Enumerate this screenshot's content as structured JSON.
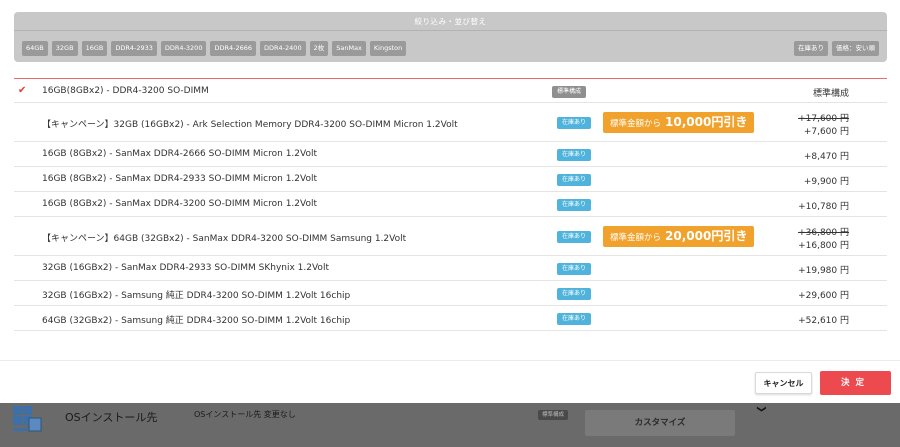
{
  "filter": {
    "title": "絞り込み・並び替え",
    "chips": [
      "64GB",
      "32GB",
      "16GB",
      "DDR4-2933",
      "DDR4-3200",
      "DDR4-2666",
      "DDR4-2400",
      "2枚",
      "SanMax",
      "Kingston"
    ],
    "sort_chips": [
      "在庫あり",
      "価格：安い順"
    ]
  },
  "options": [
    {
      "name": "16GB(8GBx2) - DDR4-3200 SO-DIMM",
      "selected": true,
      "badge": "標準構成",
      "price": "標準構成"
    },
    {
      "name": "【キャンペーン】32GB (16GBx2) - Ark Selection Memory DDR4-3200 SO-DIMM Micron 1.2Volt",
      "badge": "在庫あり",
      "promo_label": "標準金額から",
      "promo_amount": "10,000円引き",
      "old_price": "+17,600 円",
      "price": "+7,600 円"
    },
    {
      "name": "16GB (8GBx2) - SanMax DDR4-2666 SO-DIMM Micron 1.2Volt",
      "badge": "在庫あり",
      "price": "+8,470 円"
    },
    {
      "name": "16GB (8GBx2) - SanMax DDR4-2933 SO-DIMM Micron 1.2Volt",
      "badge": "在庫あり",
      "price": "+9,900 円"
    },
    {
      "name": "16GB (8GBx2) - SanMax DDR4-3200 SO-DIMM Micron 1.2Volt",
      "badge": "在庫あり",
      "price": "+10,780 円"
    },
    {
      "name": "【キャンペーン】64GB (32GBx2) - SanMax DDR4-3200 SO-DIMM Samsung 1.2Volt",
      "badge": "在庫あり",
      "promo_label": "標準金額から",
      "promo_amount": "20,000円引き",
      "old_price": "+36,800 円",
      "price": "+16,800 円"
    },
    {
      "name": "32GB (16GBx2) - SanMax DDR4-2933 SO-DIMM SKhynix 1.2Volt",
      "badge": "在庫あり",
      "price": "+19,980 円"
    },
    {
      "name": "32GB (16GBx2) - Samsung 純正 DDR4-3200 SO-DIMM 1.2Volt 16chip",
      "badge": "在庫あり",
      "price": "+29,600 円"
    },
    {
      "name": "64GB (32GBx2) - Samsung 純正 DDR4-3200 SO-DIMM 1.2Volt 16chip",
      "badge": "在庫あり",
      "price": "+52,610 円"
    }
  ],
  "actions": {
    "cancel_label": "キャンセル",
    "ok_label": "決定"
  },
  "background": {
    "section_title": "OSインストール先",
    "section_value": "OSインストール先 変更なし",
    "badge": "標準構成",
    "customize_label": "カスタマイズ"
  },
  "colors": {
    "accent_red": "#ec4a4f",
    "stock_blue": "#4fb3dc",
    "promo_orange": "#f1a22d"
  }
}
